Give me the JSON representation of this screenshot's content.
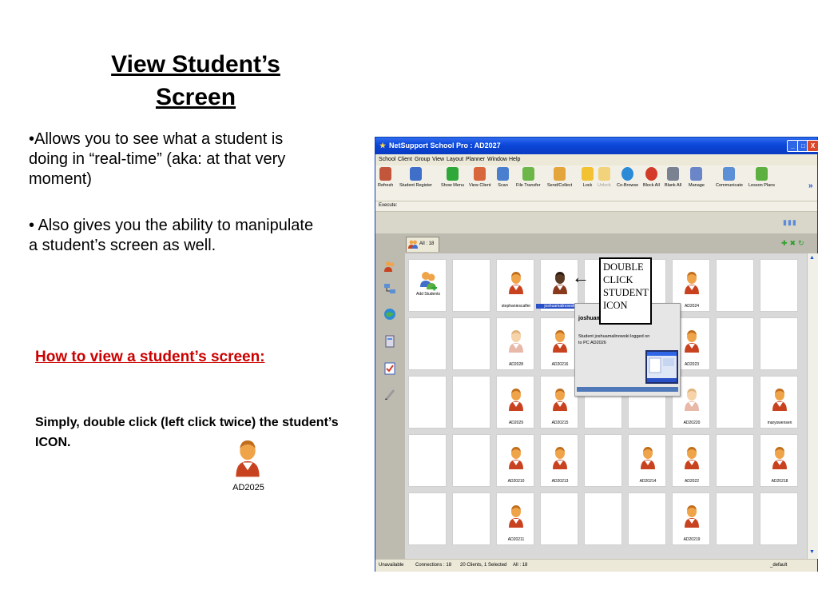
{
  "slide": {
    "title_line1": "View Student’s",
    "title_line2": "Screen",
    "bullet1": "•Allows you to see what a student is doing in “real-time” (aka: at that very moment)",
    "bullet2": "• Also gives you the ability to manipulate a student’s screen as well.",
    "howto": "How to view a student’s screen:",
    "instruction": "Simply, double click (left click twice) the student’s ICON.",
    "example_icon_label": "AD2025"
  },
  "window": {
    "title": "NetSupport School Pro : AD2027",
    "min_glyph": "_",
    "max_glyph": "□",
    "close_glyph": "X",
    "menu": [
      "School",
      "Client",
      "Group",
      "View",
      "Layout",
      "Planner",
      "Window",
      "Help"
    ],
    "toolbar": [
      {
        "label": "Refresh",
        "icon": "refresh-icon",
        "color": "#c2563a"
      },
      {
        "label": "Student Register",
        "icon": "register-icon",
        "color": "#3f6fc9"
      },
      {
        "label": "Show Menu",
        "icon": "play-icon",
        "color": "#2fa83a"
      },
      {
        "label": "View Client",
        "icon": "view-client-icon",
        "color": "#d9653a"
      },
      {
        "label": "Scan",
        "icon": "scan-icon",
        "color": "#4a7fd0"
      },
      {
        "label": "File Transfer",
        "icon": "file-transfer-icon",
        "color": "#6db64a"
      },
      {
        "label": "Send/Collect",
        "icon": "send-collect-icon",
        "color": "#e4a53a"
      },
      {
        "label": "Lock",
        "icon": "lock-icon",
        "color": "#f2c232"
      },
      {
        "label": "Unlock",
        "icon": "unlock-icon",
        "color": "#f2d27a"
      },
      {
        "label": "Co-Browse",
        "icon": "globe-icon",
        "color": "#2c8bd6"
      },
      {
        "label": "Block All",
        "icon": "block-icon",
        "color": "#d33a2a"
      },
      {
        "label": "Blank All",
        "icon": "monitor-icon",
        "color": "#7a8292"
      },
      {
        "label": "Manage",
        "icon": "manage-icon",
        "color": "#6a86c9"
      },
      {
        "label": "Communicate",
        "icon": "communicate-icon",
        "color": "#5b8fd6"
      },
      {
        "label": "Lesson Plans",
        "icon": "lesson-plans-icon",
        "color": "#5cb03f"
      }
    ],
    "execute_label": "Execute:",
    "tab_label": "All : 18",
    "grid": [
      {
        "label": "Add Students",
        "kind": "add"
      },
      {
        "label": "",
        "kind": "empty"
      },
      {
        "label": "stephaniescalfer",
        "kind": "student"
      },
      {
        "label": "joshuamalinowski",
        "kind": "dark",
        "selected": true
      },
      {
        "label": "",
        "kind": "empty"
      },
      {
        "label": "",
        "kind": "empty"
      },
      {
        "label": "AD2024",
        "kind": "student"
      },
      {
        "label": "",
        "kind": "empty"
      },
      {
        "label": "",
        "kind": "empty"
      },
      {
        "label": "",
        "kind": "empty"
      },
      {
        "label": "",
        "kind": "empty"
      },
      {
        "label": "AD2028",
        "kind": "faded"
      },
      {
        "label": "AD20216",
        "kind": "student"
      },
      {
        "label": "",
        "kind": "empty"
      },
      {
        "label": "",
        "kind": "empty"
      },
      {
        "label": "AD2023",
        "kind": "student"
      },
      {
        "label": "",
        "kind": "empty"
      },
      {
        "label": "",
        "kind": "empty"
      },
      {
        "label": "",
        "kind": "empty"
      },
      {
        "label": "",
        "kind": "empty"
      },
      {
        "label": "AD2029",
        "kind": "student"
      },
      {
        "label": "AD20215",
        "kind": "student"
      },
      {
        "label": "",
        "kind": "empty"
      },
      {
        "label": "",
        "kind": "empty"
      },
      {
        "label": "AD20220",
        "kind": "faded"
      },
      {
        "label": "",
        "kind": "empty"
      },
      {
        "label": "maryswensen",
        "kind": "student"
      },
      {
        "label": "",
        "kind": "empty"
      },
      {
        "label": "",
        "kind": "empty"
      },
      {
        "label": "AD20210",
        "kind": "student"
      },
      {
        "label": "AD20213",
        "kind": "student"
      },
      {
        "label": "",
        "kind": "empty"
      },
      {
        "label": "AD20214",
        "kind": "student"
      },
      {
        "label": "AD2022",
        "kind": "student"
      },
      {
        "label": "",
        "kind": "empty"
      },
      {
        "label": "AD20218",
        "kind": "student"
      },
      {
        "label": "",
        "kind": "empty"
      },
      {
        "label": "",
        "kind": "empty"
      },
      {
        "label": "AD20211",
        "kind": "student"
      },
      {
        "label": "",
        "kind": "empty"
      },
      {
        "label": "",
        "kind": "empty"
      },
      {
        "label": "",
        "kind": "empty"
      },
      {
        "label": "AD20219",
        "kind": "student"
      },
      {
        "label": "",
        "kind": "empty"
      },
      {
        "label": "",
        "kind": "empty"
      }
    ],
    "status": {
      "availability": "Unavailable",
      "connections": "Connections : 18",
      "selection": "20 Clients, 1 Selected",
      "all": "All : 18",
      "profile": "_default"
    },
    "popup": {
      "name": "joshuam",
      "text": "Student joshuamalinowski logged on to PC AD2026"
    },
    "callout": [
      "DOUBLE",
      "CLICK",
      "STUDENT",
      "ICON"
    ],
    "arrow": "←"
  },
  "colors": {
    "title_bar": "#0b46d8",
    "howto_text": "#cc0000",
    "student_body": "#c9421f",
    "student_head": "#f0a44a",
    "selection": "#2a50c8"
  }
}
